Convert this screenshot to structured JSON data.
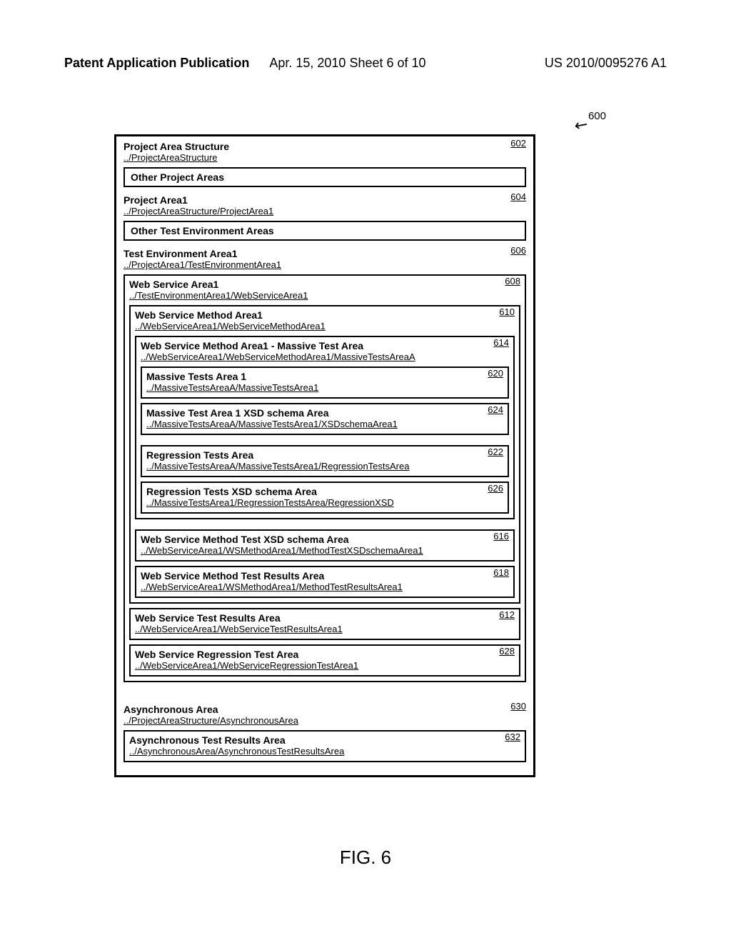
{
  "header": {
    "left": "Patent Application Publication",
    "mid": "Apr. 15, 2010  Sheet 6 of 10",
    "right": "US 2010/0095276 A1"
  },
  "pointer": "600",
  "figure_caption": "FIG. 6",
  "root": {
    "title": "Project Area Structure",
    "path": "../ProjectAreaStructure",
    "num": "602",
    "other_proj_header": "Other Project Areas",
    "proj": {
      "title": "Project Area1",
      "path": "../ProjectAreaStructure/ProjectArea1",
      "num": "604",
      "other_env_header": "Other Test Environment Areas",
      "env": {
        "title": "Test Environment Area1",
        "path": "../ProjectArea1/TestEnvironmentArea1",
        "num": "606",
        "ws": {
          "title": "Web Service Area1",
          "path": "../TestEnvironmentArea1/WebServiceArea1",
          "num": "608",
          "method": {
            "title": "Web Service Method Area1",
            "path": "../WebServiceArea1/WebServiceMethodArea1",
            "num": "610",
            "massive": {
              "title": "Web Service Method Area1 - Massive Test Area",
              "path": "../WebServiceArea1/WebServiceMethodArea1/MassiveTestsAreaA",
              "num": "614",
              "mt1": {
                "title": "Massive Tests Area 1",
                "path": "../MassiveTestsAreaA/MassiveTestsArea1",
                "num": "620"
              },
              "mt1xsd": {
                "title": "Massive Test Area 1 XSD schema Area",
                "path": "../MassiveTestsAreaA/MassiveTestsArea1/XSDschemaArea1",
                "num": "624"
              },
              "reg": {
                "title": "Regression Tests Area",
                "path": "../MassiveTestsAreaA/MassiveTestsArea1/RegressionTestsArea",
                "num": "622"
              },
              "regxsd": {
                "title": "Regression Tests XSD schema Area",
                "path": "../MassiveTestsArea1/RegressionTestsArea/RegressionXSD",
                "num": "626"
              }
            },
            "methodxsd": {
              "title": "Web Service Method Test XSD schema Area",
              "path": "../WebServiceArea1/WSMethodArea1/MethodTestXSDschemaArea1",
              "num": "616"
            },
            "methodres": {
              "title": "Web Service Method Test Results Area",
              "path": "../WebServiceArea1/WSMethodArea1/MethodTestResultsArea1",
              "num": "618"
            }
          },
          "wsres": {
            "title": "Web Service Test Results Area",
            "path": "../WebServiceArea1/WebServiceTestResultsArea1",
            "num": "612"
          },
          "wsreg": {
            "title": "Web Service Regression Test Area",
            "path": "../WebServiceArea1/WebServiceRegressionTestArea1",
            "num": "628"
          }
        }
      }
    },
    "async": {
      "title": "Asynchronous Area",
      "path": "../ProjectAreaStructure/AsynchronousArea",
      "num": "630",
      "res": {
        "title": "Asynchronous Test Results Area",
        "path": "../AsynchronousArea/AsynchronousTestResultsArea",
        "num": "632"
      }
    }
  }
}
